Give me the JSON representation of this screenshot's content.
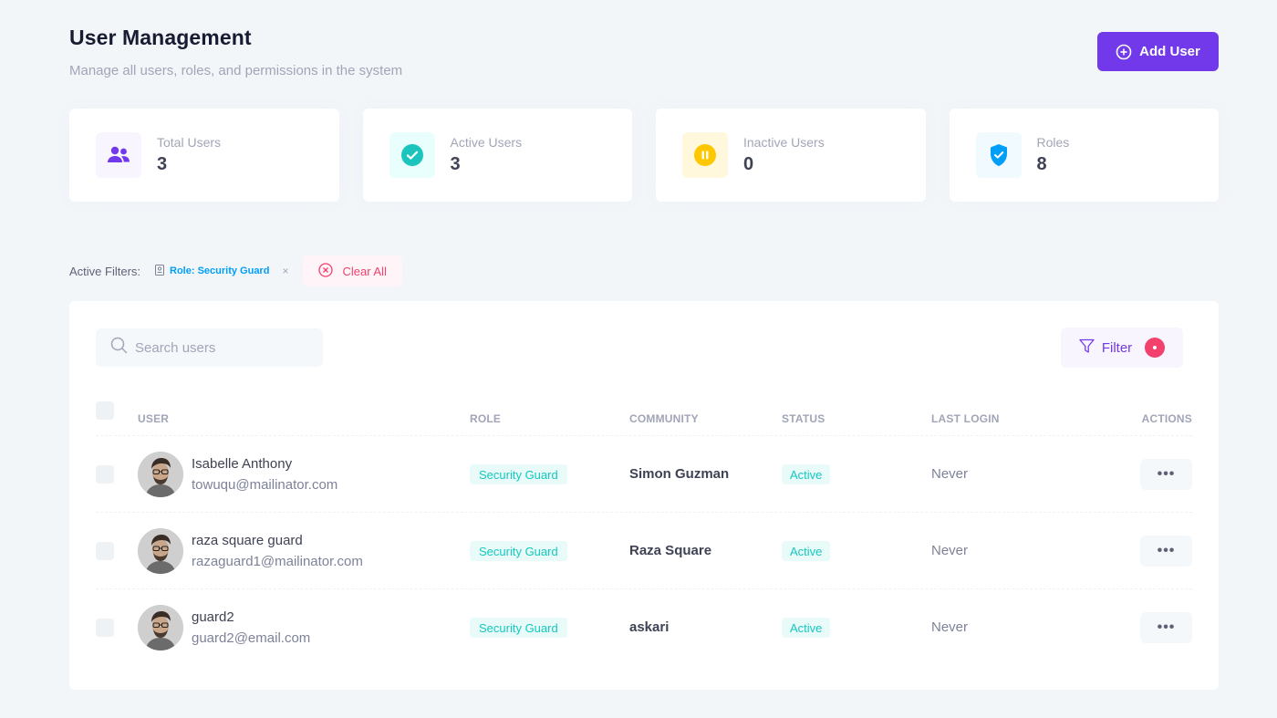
{
  "header": {
    "title": "User Management",
    "subtitle": "Manage all users, roles, and permissions in the system",
    "add_user_label": "Add User"
  },
  "stats": [
    {
      "label": "Total Users",
      "value": "3",
      "icon": "users-icon",
      "color": "#7239ea",
      "bg": "#f8f5ff"
    },
    {
      "label": "Active Users",
      "value": "3",
      "icon": "check-circle-icon",
      "color": "#1bc5bd",
      "bg": "#e8fffd"
    },
    {
      "label": "Inactive Users",
      "value": "0",
      "icon": "pause-circle-icon",
      "color": "#ffc700",
      "bg": "#fff8dd"
    },
    {
      "label": "Roles",
      "value": "8",
      "icon": "shield-check-icon",
      "color": "#009ef7",
      "bg": "#f1faff"
    }
  ],
  "filters": {
    "label": "Active Filters:",
    "chip_label": "Role: Security Guard",
    "chip_close": "×",
    "clear_all_label": "Clear All"
  },
  "table": {
    "search_placeholder": "Search users",
    "filter_label": "Filter",
    "columns": {
      "user": "USER",
      "role": "ROLE",
      "community": "COMMUNITY",
      "status": "STATUS",
      "last_login": "LAST LOGIN",
      "actions": "ACTIONS"
    },
    "rows": [
      {
        "name": "Isabelle Anthony",
        "email": "towuqu@mailinator.com",
        "role": "Security Guard",
        "community": "Simon Guzman",
        "status": "Active",
        "last_login": "Never",
        "actions": "•••"
      },
      {
        "name": "raza square guard",
        "email": "razaguard1@mailinator.com",
        "role": "Security Guard",
        "community": "Raza Square",
        "status": "Active",
        "last_login": "Never",
        "actions": "•••"
      },
      {
        "name": "guard2",
        "email": "guard2@email.com",
        "role": "Security Guard",
        "community": "askari",
        "status": "Active",
        "last_login": "Never",
        "actions": "•••"
      }
    ]
  },
  "colors": {
    "primary": "#7239ea",
    "danger": "#f1416c",
    "info": "#009ef7",
    "success": "#1bc5bd"
  }
}
